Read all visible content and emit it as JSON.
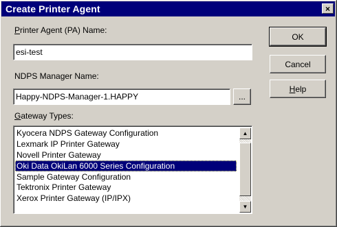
{
  "window": {
    "title": "Create Printer Agent",
    "close_glyph": "×"
  },
  "fields": {
    "pa_name": {
      "label_mnemonic": "P",
      "label_rest": "rinter Agent (PA) Name:",
      "value": "esi-test"
    },
    "ndps_manager": {
      "label": "NDPS Manager Name:",
      "value": "Happy-NDPS-Manager-1.HAPPY",
      "browse_label": "..."
    }
  },
  "gateway": {
    "label_mnemonic": "G",
    "label_rest": "ateway Types:",
    "selected_index": 3,
    "items": [
      "Kyocera NDPS Gateway Configuration",
      "Lexmark IP Printer Gateway",
      "Novell Printer Gateway",
      "Oki Data OkiLan 6000 Series Configuration",
      "Sample Gateway Configuration",
      "Tektronix Printer Gateway",
      "Xerox Printer Gateway (IP/IPX)"
    ]
  },
  "buttons": {
    "ok": "OK",
    "cancel": "Cancel",
    "help_mnemonic": "H",
    "help_rest": "elp"
  },
  "icons": {
    "scroll_up": "▲",
    "scroll_down": "▼"
  }
}
